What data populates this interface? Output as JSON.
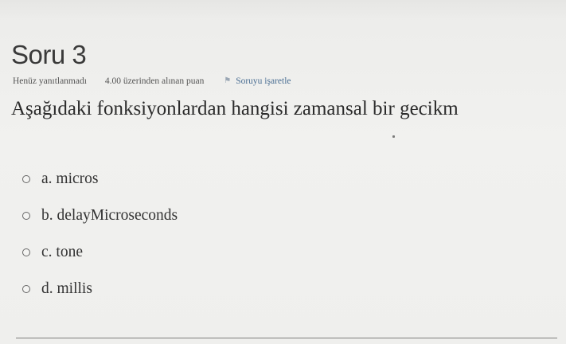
{
  "question": {
    "title": "Soru 3",
    "state": "Henüz yanıtlanmadı",
    "grade": "4.00 üzerinden alınan puan",
    "flag_label": "Soruyu işaretle",
    "text": "Aşağıdaki fonksiyonlardan hangisi zamansal bir gecikm",
    "answers": [
      {
        "label": "a. micros"
      },
      {
        "label": "b. delayMicroseconds"
      },
      {
        "label": "c. tone"
      },
      {
        "label": "d. millis"
      }
    ]
  }
}
